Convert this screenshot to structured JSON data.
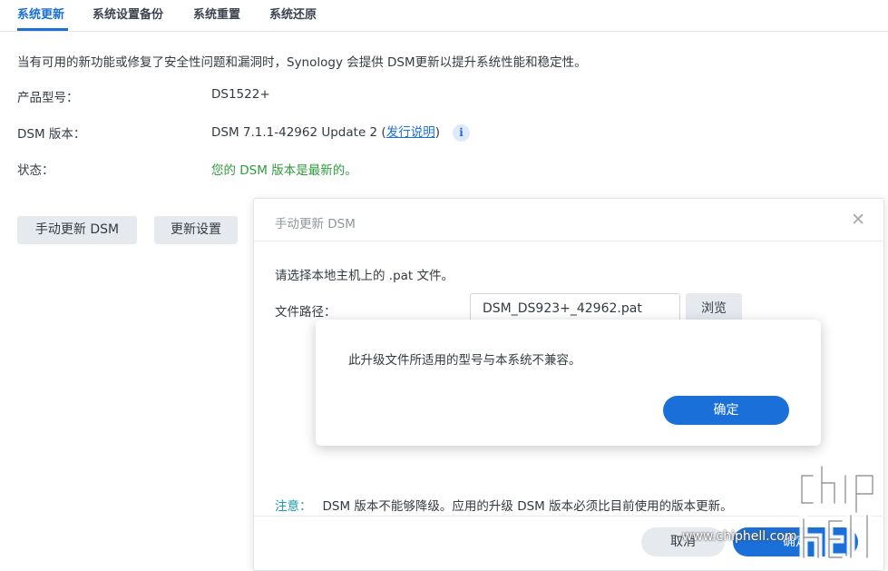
{
  "tabs": [
    {
      "label": "系统更新",
      "active": true
    },
    {
      "label": "系统设置备份"
    },
    {
      "label": "系统重置"
    },
    {
      "label": "系统还原"
    }
  ],
  "description": "当有可用的新功能或修复了安全性问题和漏洞时，Synology 会提供 DSM更新以提升系统性能和稳定性。",
  "info": {
    "model_label": "产品型号：",
    "model_value": "DS1522+",
    "version_label": "DSM 版本：",
    "version_value": "DSM 7.1.1-42962 Update 2 (",
    "release_notes_link": "发行说明",
    "version_suffix": ")",
    "status_label": "状态：",
    "status_value": "您的 DSM 版本是最新的。"
  },
  "buttons": {
    "manual_update": "手动更新 DSM",
    "update_settings": "更新设置"
  },
  "dialog": {
    "title": "手动更新 DSM",
    "close_glyph": "✕",
    "instruction": "请选择本地主机上的 .pat 文件。",
    "file_path_label": "文件路径：",
    "file_path_value": "DSM_DS923+_42962.pat",
    "browse": "浏览",
    "note_label": "注意：",
    "note_text": "DSM 版本不能够降级。应用的升级 DSM 版本必须比目前使用的版本更新。",
    "cancel": "取消",
    "confirm": "确定"
  },
  "alert": {
    "message": "此升级文件所适用的型号与本系统不兼容。",
    "confirm": "确定"
  },
  "watermark": {
    "url": "www.chiphell.com",
    "logo_text": "chip hell"
  },
  "colors": {
    "accent": "#1a6fd8",
    "status_ok": "#2e9a3c",
    "note_label": "#1a9aa6"
  }
}
